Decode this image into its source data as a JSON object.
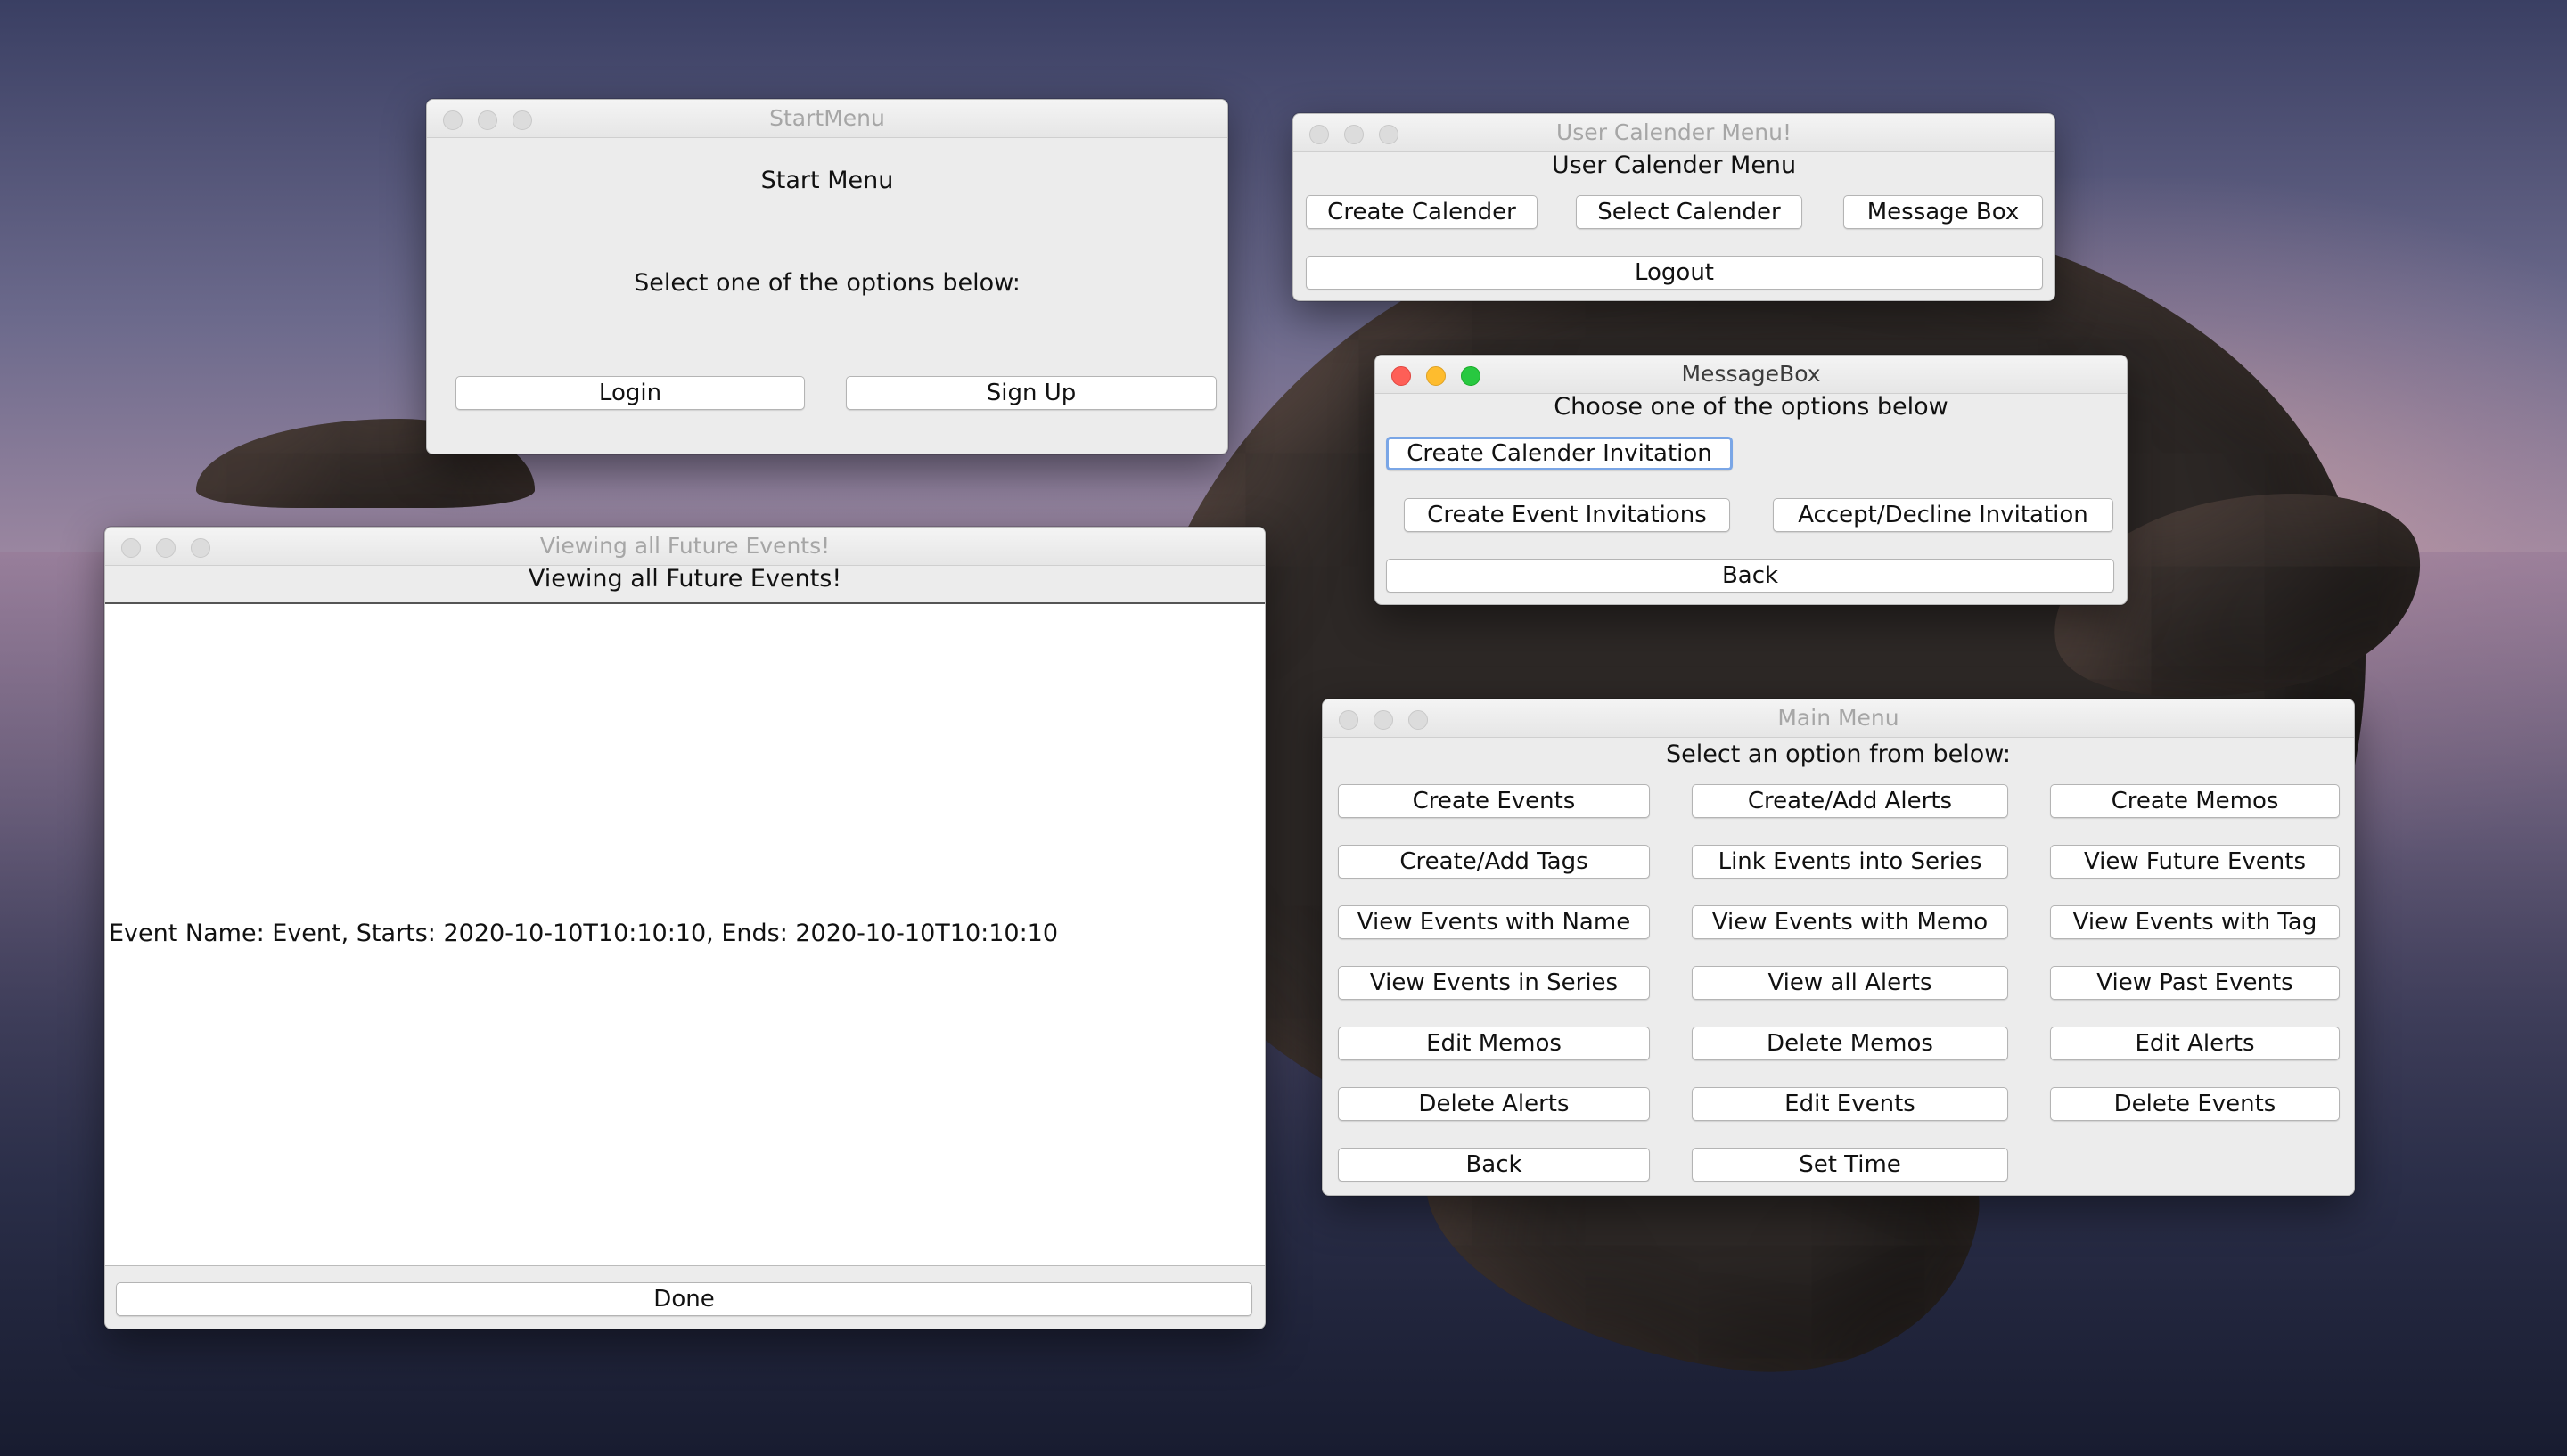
{
  "start_menu": {
    "window_title": "StartMenu",
    "heading": "Start Menu",
    "prompt": "Select one of the options below:",
    "buttons": {
      "login": "Login",
      "sign_up": "Sign Up"
    }
  },
  "user_calendar_menu": {
    "window_title": "User Calender Menu!",
    "heading": "User Calender Menu",
    "buttons": {
      "create_calendar": "Create Calender",
      "select_calendar": "Select Calender",
      "message_box": "Message Box",
      "logout": "Logout"
    }
  },
  "message_box": {
    "window_title": "MessageBox",
    "heading": "Choose one of the options below",
    "buttons": {
      "create_calendar_invitation": "Create Calender Invitation",
      "create_event_invitations": "Create Event Invitations",
      "accept_decline_invitation": "Accept/Decline Invitation",
      "back": "Back"
    }
  },
  "future_events": {
    "window_title": "Viewing all Future Events!",
    "heading": "Viewing all Future Events!",
    "event_line": "Event Name: Event, Starts: 2020-10-10T10:10:10, Ends: 2020-10-10T10:10:10",
    "done_label": "Done"
  },
  "main_menu": {
    "window_title": "Main Menu",
    "heading": "Select an option from below:",
    "buttons": [
      "Create Events",
      "Create/Add Alerts",
      "Create Memos",
      "Create/Add Tags",
      "Link Events into Series",
      "View Future Events",
      "View Events with Name",
      "View Events with Memo",
      "View Events with Tag",
      "View Events in Series",
      "View all Alerts",
      "View Past Events",
      "Edit Memos",
      "Delete Memos",
      "Edit Alerts",
      "Delete Alerts",
      "Edit Events",
      "Delete Events",
      "Back",
      "Set Time"
    ]
  }
}
